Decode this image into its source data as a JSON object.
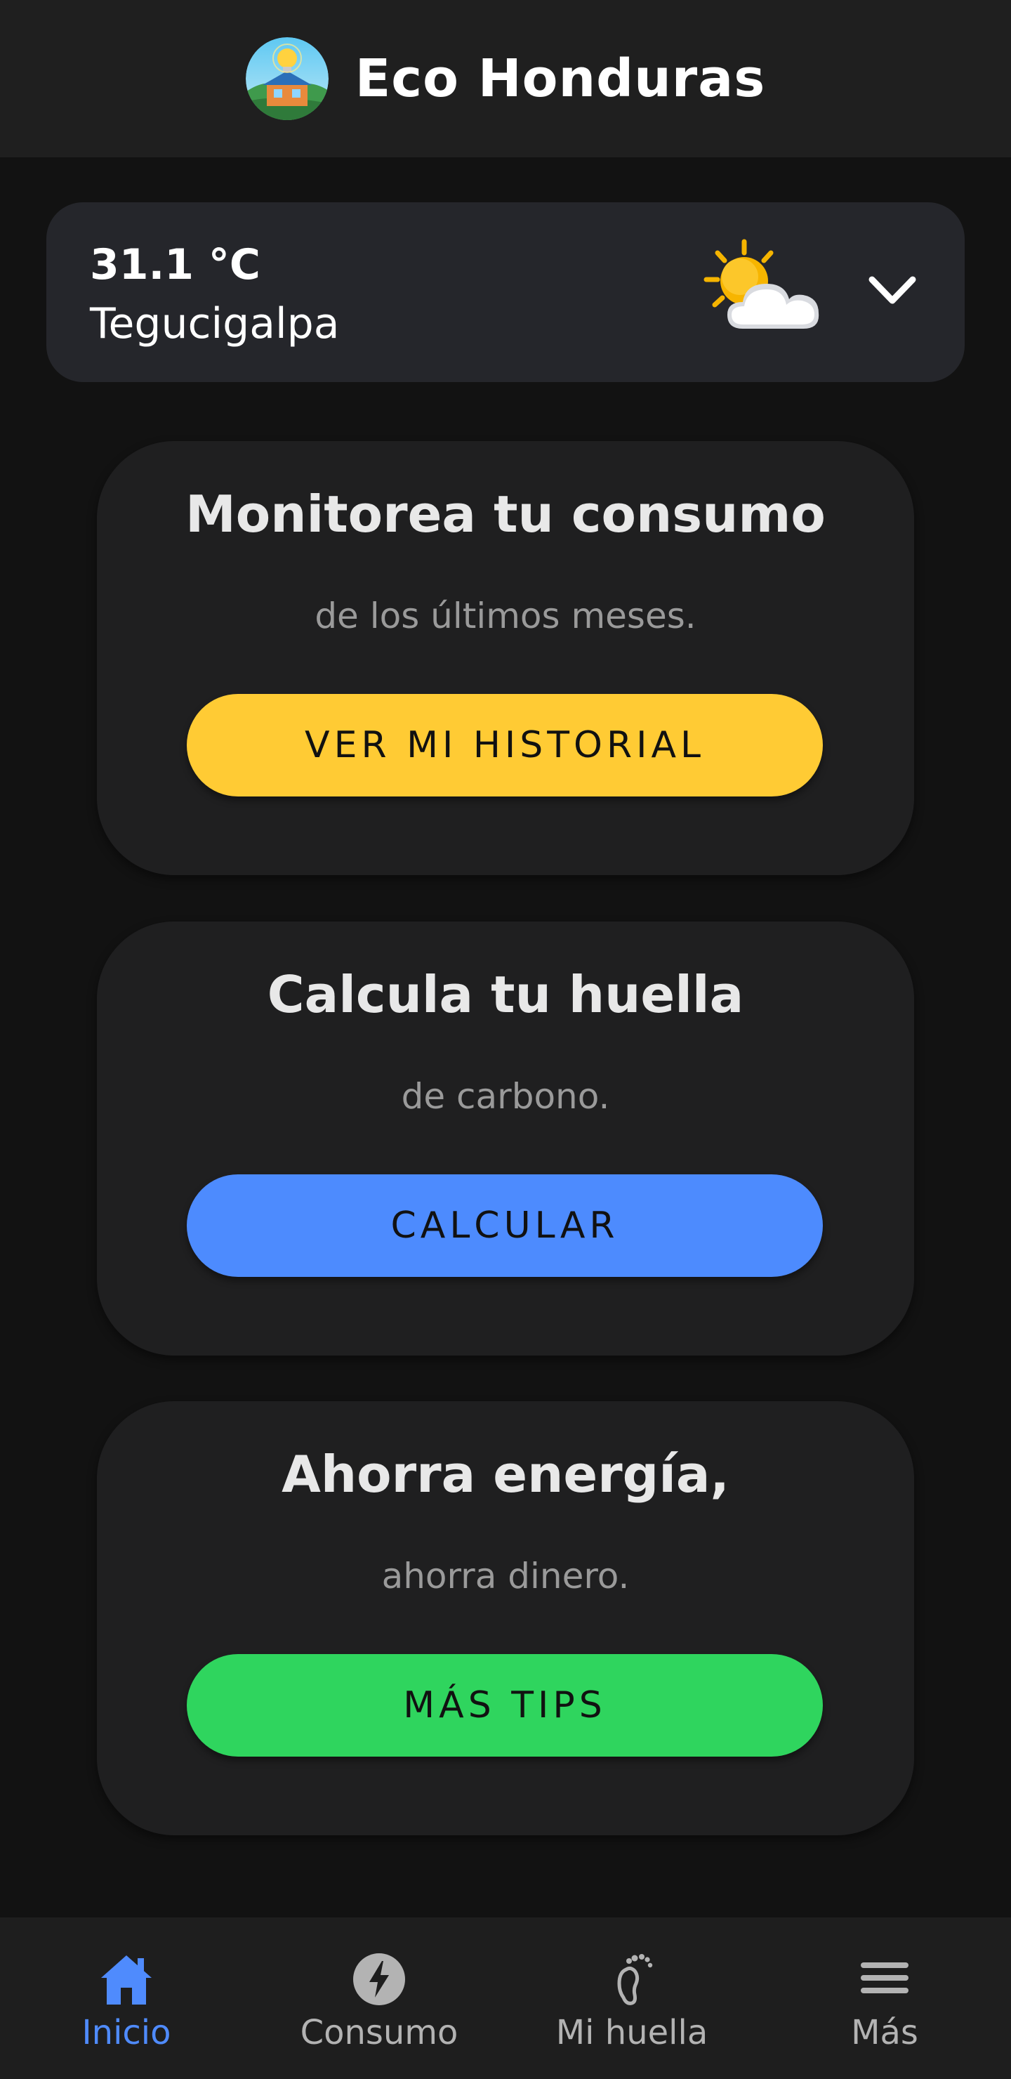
{
  "header": {
    "title": "Eco Honduras",
    "logo_icon": "house-lightbulb-logo"
  },
  "weather": {
    "temperature": "31.1 °C",
    "city": "Tegucigalpa",
    "icon": "partly-sunny-icon",
    "expand_icon": "chevron-down-icon"
  },
  "cards": [
    {
      "title": "Monitorea tu consumo",
      "subtitle": "de los últimos meses.",
      "button_label": "VER MI HISTORIAL",
      "button_color": "#ffcb34"
    },
    {
      "title": "Calcula tu huella",
      "subtitle": "de carbono.",
      "button_label": "CALCULAR",
      "button_color": "#4d8bfe"
    },
    {
      "title": "Ahorra energía,",
      "subtitle": "ahorra dinero.",
      "button_label": "MÁS TIPS",
      "button_color": "#2fd55e"
    }
  ],
  "nav": {
    "items": [
      {
        "label": "Inicio",
        "icon": "home-icon",
        "active": true
      },
      {
        "label": "Consumo",
        "icon": "lightning-icon",
        "active": false
      },
      {
        "label": "Mi huella",
        "icon": "footprint-icon",
        "active": false
      },
      {
        "label": "Más",
        "icon": "menu-icon",
        "active": false
      }
    ]
  },
  "colors": {
    "accent": "#4f8bfd",
    "background": "#121212",
    "surface": "#1f1f20"
  }
}
